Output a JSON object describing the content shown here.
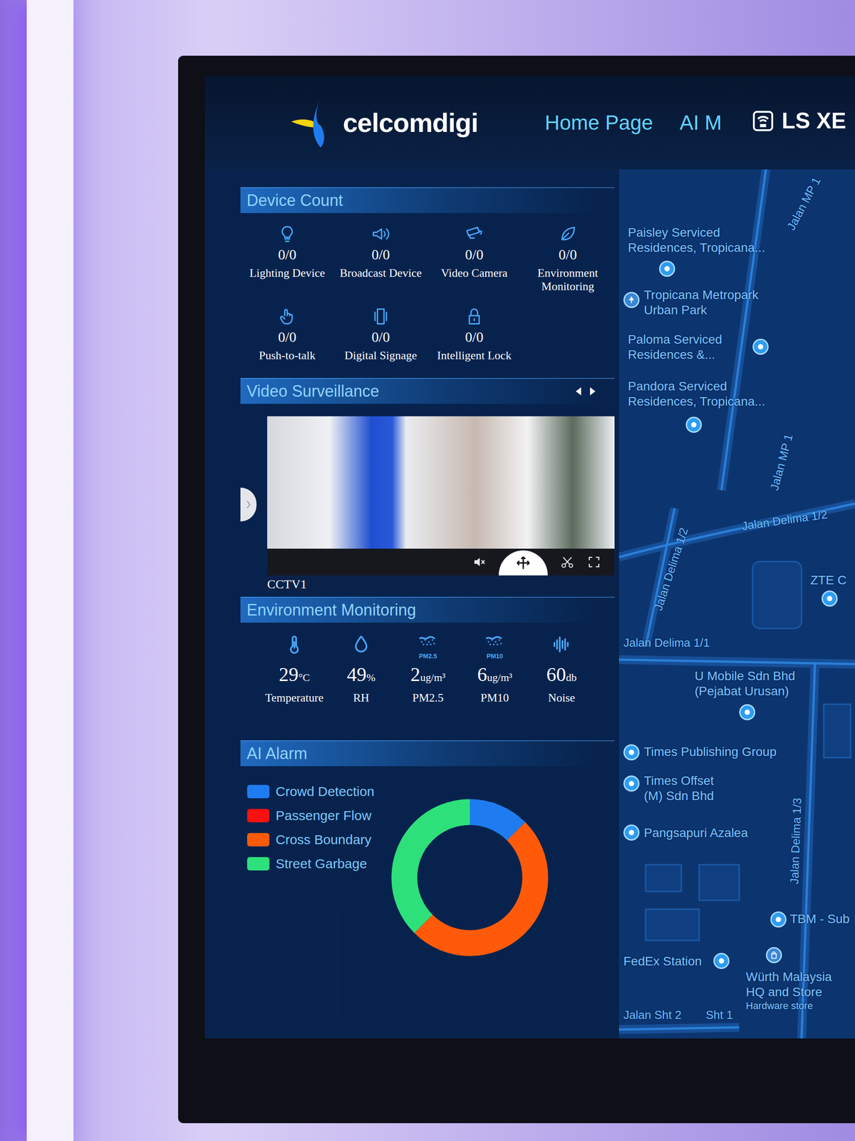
{
  "header": {
    "logo": "celcomdigi",
    "nav": [
      "Home Page",
      "AI M"
    ],
    "overlay": "LS XE"
  },
  "device_count": {
    "title": "Device Count",
    "devices": [
      {
        "label": "Lighting Device",
        "value": "0/0"
      },
      {
        "label": "Broadcast Device",
        "value": "0/0"
      },
      {
        "label": "Video Camera",
        "value": "0/0"
      },
      {
        "label": "Environment Monitoring",
        "value": "0/0"
      },
      {
        "label": "Push-to-talk",
        "value": "0/0"
      },
      {
        "label": "Digital Signage",
        "value": "0/0"
      },
      {
        "label": "Intelligent Lock",
        "value": "0/0"
      }
    ]
  },
  "video_surveillance": {
    "title": "Video Surveillance",
    "camera": "CCTV1",
    "muted": true
  },
  "environment": {
    "title": "Environment Monitoring",
    "readings": [
      {
        "label": "Temperature",
        "value": "29",
        "unit": "°C"
      },
      {
        "label": "RH",
        "value": "49",
        "unit": "%"
      },
      {
        "label": "PM2.5",
        "value": "2",
        "unit": "ug/m³",
        "badge": "PM2.5"
      },
      {
        "label": "PM10",
        "value": "6",
        "unit": "ug/m³",
        "badge": "PM10"
      },
      {
        "label": "Noise",
        "value": "60",
        "unit": "db"
      }
    ]
  },
  "ai_alarm": {
    "title": "AI Alarm",
    "series": [
      {
        "label": "Crowd Detection",
        "color": "#1e7cf0",
        "values": [
          1
        ]
      },
      {
        "label": "Passenger Flow",
        "color": "#ff1010",
        "values": [
          0
        ]
      },
      {
        "label": "Cross Boundary",
        "color": "#ff5a0a",
        "values": [
          4
        ]
      },
      {
        "label": "Street Garbage",
        "color": "#2ee07a",
        "values": [
          3
        ]
      }
    ]
  },
  "map": {
    "streets": [
      "Jalan MP 1",
      "Jalan MP 1",
      "Jalan Delima 1/2",
      "Jalan Delima 1/2",
      "Jalan Delima 1/1",
      "Jalan Delima 1/3",
      "Jalan Sht 2",
      "Sht 1"
    ],
    "places": [
      {
        "lines": [
          "Paisley Serviced",
          "Residences, Tropicana..."
        ],
        "kind": "pin"
      },
      {
        "lines": [
          "Tropicana Metropark",
          "Urban Park"
        ],
        "kind": "park"
      },
      {
        "lines": [
          "Paloma Serviced",
          "Residences &..."
        ],
        "kind": "pin"
      },
      {
        "lines": [
          "Pandora Serviced",
          "Residences, Tropicana..."
        ],
        "kind": "pin"
      },
      {
        "lines": [
          "ZTE C"
        ],
        "kind": "pin"
      },
      {
        "lines": [
          "U Mobile Sdn Bhd",
          "(Pejabat Urusan)"
        ],
        "kind": "pin"
      },
      {
        "lines": [
          "Times Publishing Group"
        ],
        "kind": "pin"
      },
      {
        "lines": [
          "Times Offset",
          "(M) Sdn Bhd"
        ],
        "kind": "pin"
      },
      {
        "lines": [
          "Pangsapuri Azalea"
        ],
        "kind": "pin"
      },
      {
        "lines": [
          "TBM - Sub"
        ],
        "kind": "pin"
      },
      {
        "lines": [
          "FedEx Station"
        ],
        "kind": "pin"
      },
      {
        "lines": [
          "Würth Malaysia",
          "HQ and Store"
        ],
        "note": "Hardware store",
        "kind": "store"
      }
    ]
  }
}
